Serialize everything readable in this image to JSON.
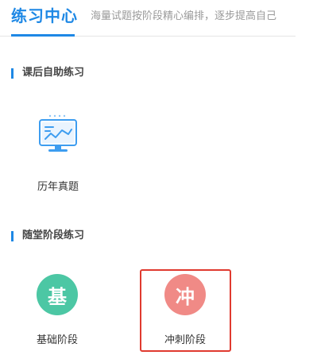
{
  "header": {
    "title": "练习中心",
    "subtitle": "海量试题按阶段精心编排，逐步提高自己"
  },
  "sections": [
    {
      "label": "课后自助练习",
      "items": [
        {
          "label": "历年真题",
          "icon": "monitor-chart-icon"
        }
      ]
    },
    {
      "label": "随堂阶段练习",
      "items": [
        {
          "label": "基础阶段",
          "icon_char": "基",
          "icon_color": "#4cc7a4"
        },
        {
          "label": "冲刺阶段",
          "icon_char": "冲",
          "icon_color": "#f08a86"
        }
      ]
    }
  ],
  "colors": {
    "accent": "#1e88e5",
    "highlight_border": "#e03a2f"
  }
}
